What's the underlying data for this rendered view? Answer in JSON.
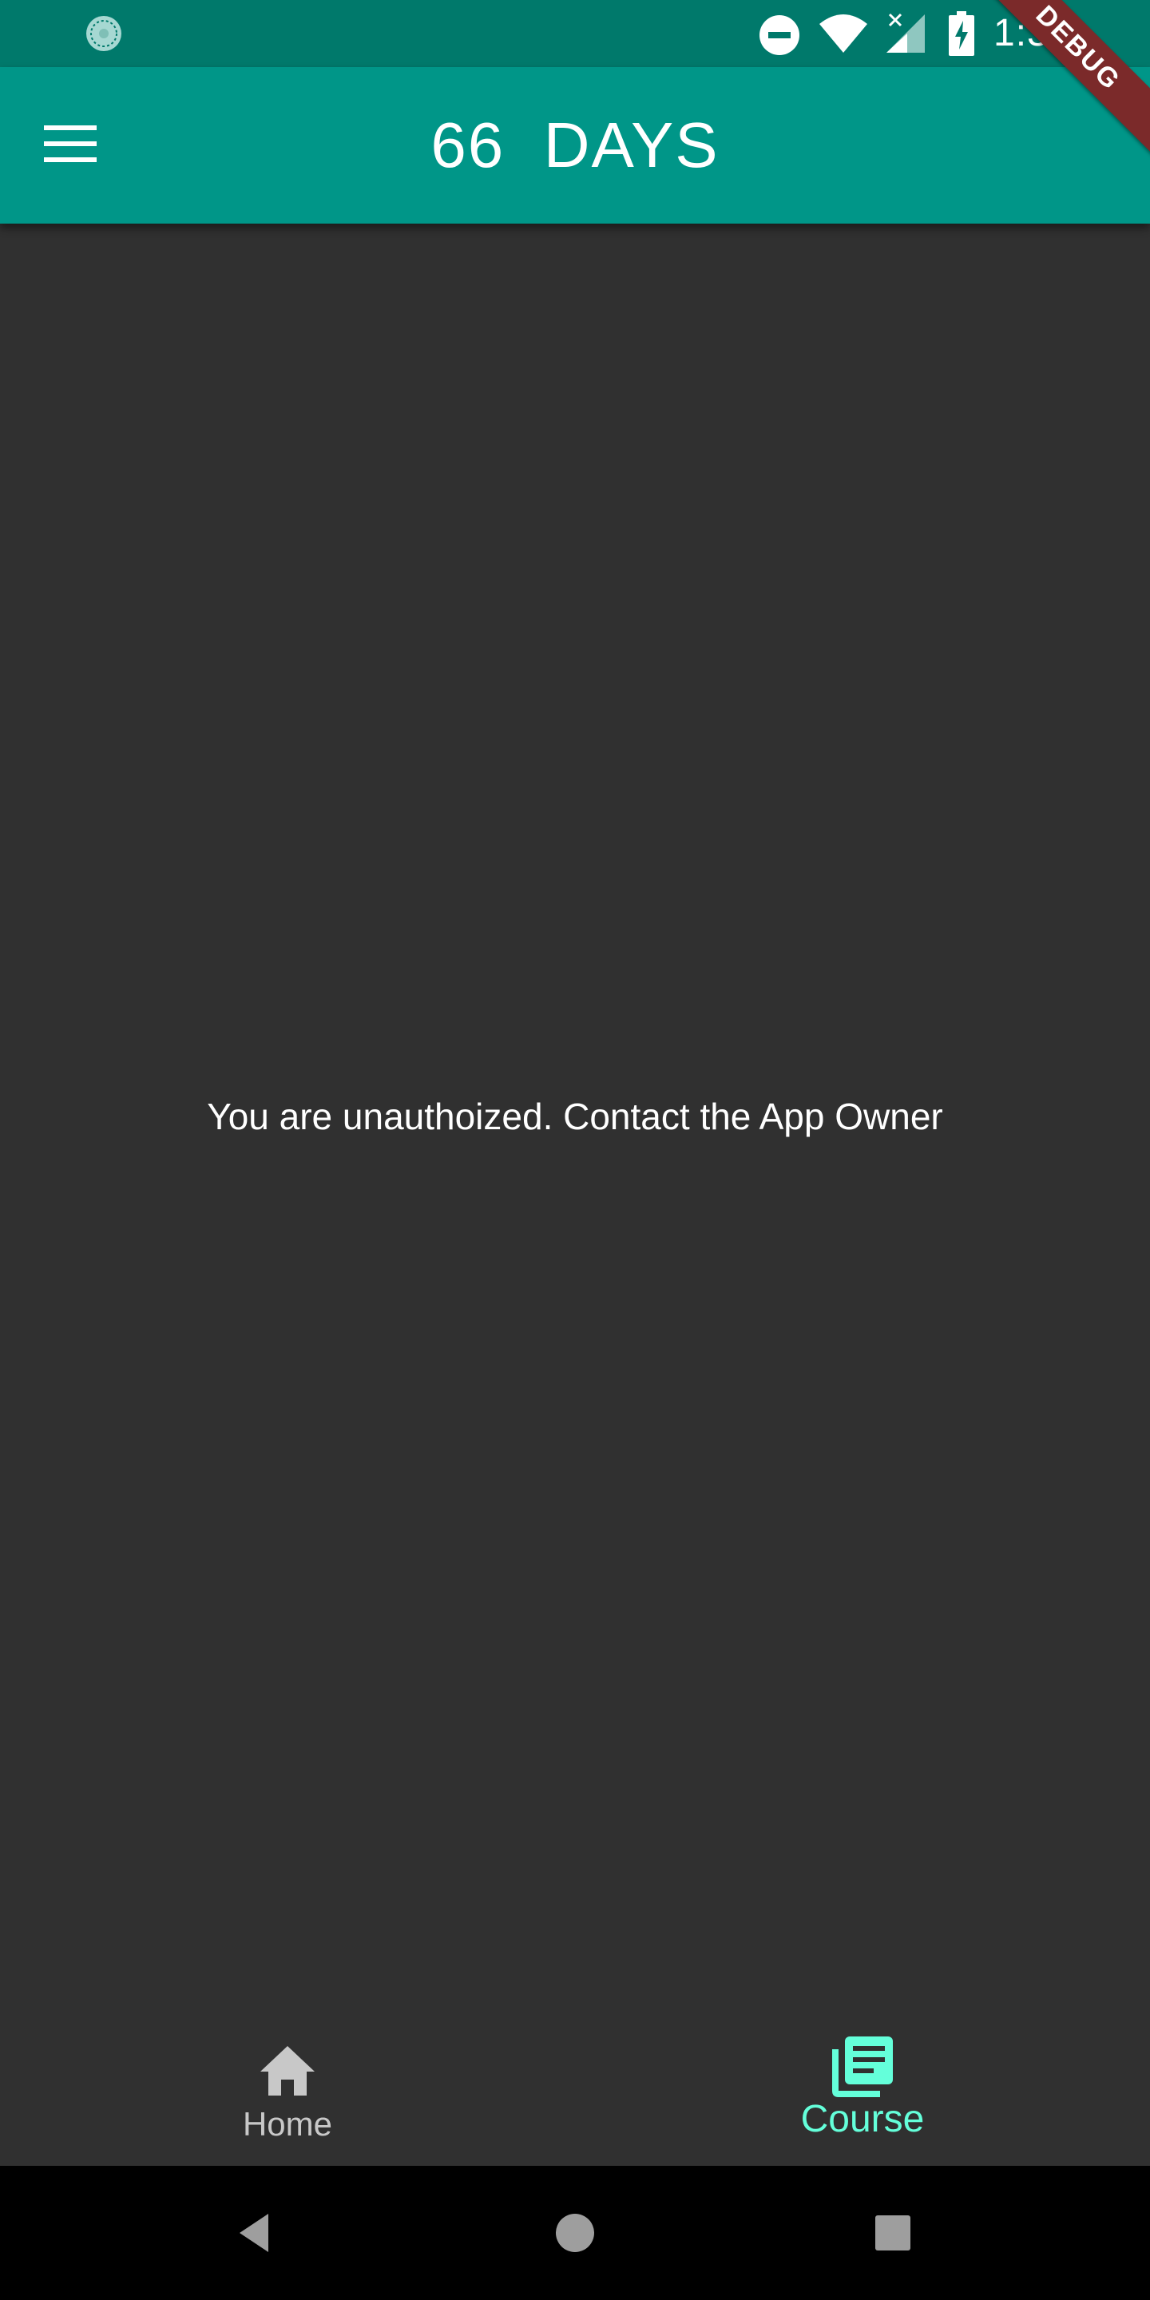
{
  "status_bar": {
    "time": "1:36",
    "icons": [
      "sync-icon",
      "do-not-disturb-icon",
      "wifi-icon",
      "signal-icon",
      "battery-charging-icon"
    ]
  },
  "app_bar": {
    "title": "66  DAYS",
    "menu_icon": "hamburger-menu-icon"
  },
  "debug_banner": {
    "label": "DEBUG"
  },
  "main": {
    "message": "You are unauthoized. Contact the App Owner"
  },
  "bottom_nav": {
    "items": [
      {
        "label": "Home",
        "icon": "home-icon",
        "selected": false
      },
      {
        "label": "Course",
        "icon": "library-books-icon",
        "selected": true
      }
    ]
  },
  "system_nav": {
    "buttons": [
      "back-icon",
      "home-circle-icon",
      "recents-icon"
    ]
  },
  "colors": {
    "status_bar": "#00796b",
    "app_bar": "#009688",
    "background": "#303030",
    "accent": "#64ffda",
    "debug_banner": "#7b2a2a"
  }
}
